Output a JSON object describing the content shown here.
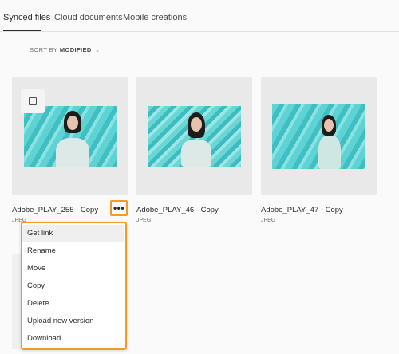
{
  "tabs": [
    {
      "label": "Synced files",
      "active": true
    },
    {
      "label": "Cloud documents",
      "active": false
    },
    {
      "label": "Mobile creations",
      "active": false
    }
  ],
  "sort": {
    "prefix": "SORT BY",
    "value": "MODIFIED",
    "icon": "chevron-down-icon"
  },
  "files": [
    {
      "name": "Adobe_PLAY_255 - Copy",
      "type": "JPEG"
    },
    {
      "name": "Adobe_PLAY_46 - Copy",
      "type": "JPEG"
    },
    {
      "name": "Adobe_PLAY_47 - Copy",
      "type": "JPEG"
    }
  ],
  "more_button": {
    "icon": "more-options-icon",
    "label": "•••"
  },
  "context_menu": {
    "items": [
      "Get link",
      "Rename",
      "Move",
      "Copy",
      "Delete",
      "Upload new version",
      "Download"
    ],
    "highlighted": "Get link"
  },
  "colors": {
    "highlight": "#f59b23",
    "card_bg": "#e9e9e9"
  }
}
